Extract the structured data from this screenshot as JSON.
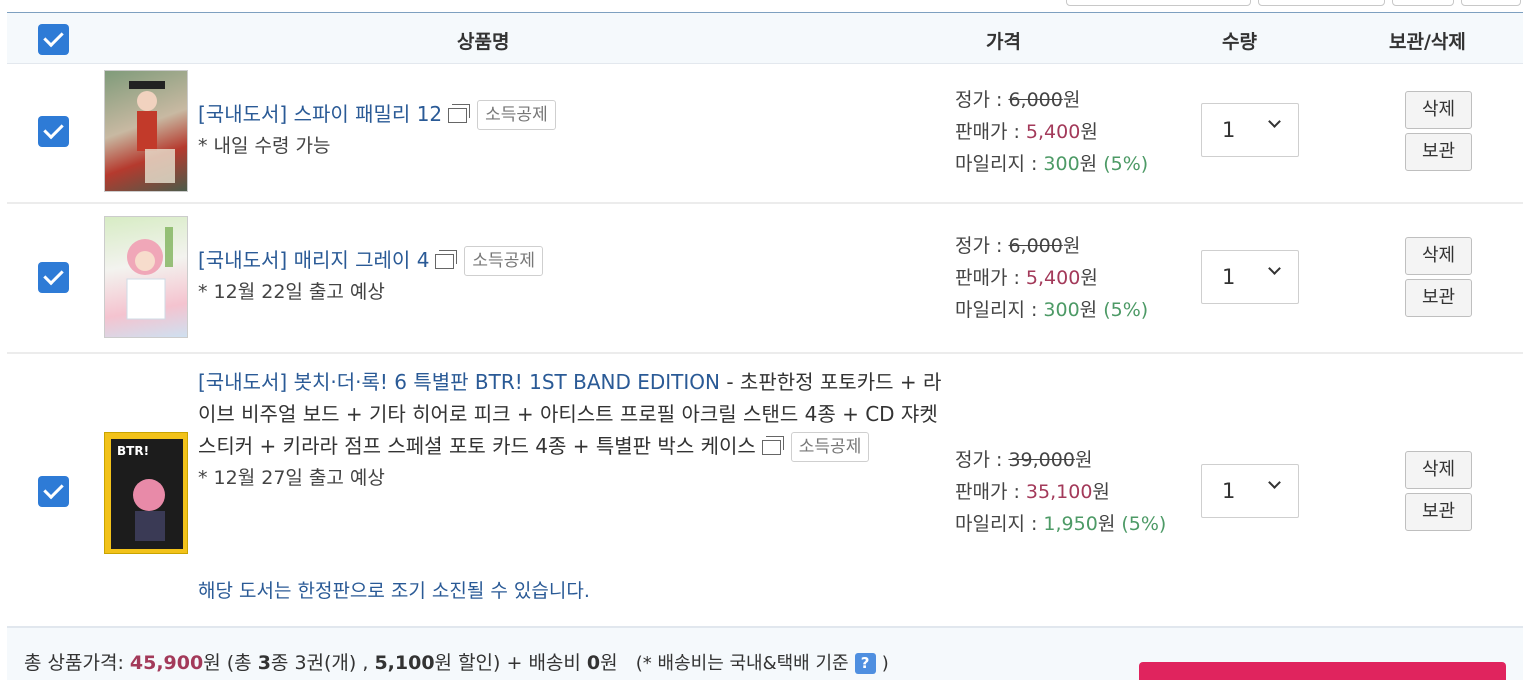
{
  "header": {
    "col_name": "상품명",
    "col_price": "가격",
    "col_qty": "수량",
    "col_action": "보관/삭제"
  },
  "items": [
    {
      "category": "[국내도서]",
      "title": "스파이 패밀리 12",
      "title_rest": "",
      "badge": "소득공제",
      "shipping": "* 내일 수령 가능",
      "list_label": "정가 : ",
      "list_price": "6,000",
      "sale_label": "판매가 : ",
      "sale_price": "5,400",
      "mileage_label": "마일리지 : ",
      "mileage": "300",
      "mileage_rate": "(5%)",
      "currency": "원",
      "qty": "1",
      "delete_label": "삭제",
      "keep_label": "보관",
      "cover_colors": [
        "#6e8a6a",
        "#c23a2a"
      ]
    },
    {
      "category": "[국내도서]",
      "title": "매리지 그레이 4",
      "title_rest": "",
      "badge": "소득공제",
      "shipping": "* 12월 22일 출고 예상",
      "list_label": "정가 : ",
      "list_price": "6,000",
      "sale_label": "판매가 : ",
      "sale_price": "5,400",
      "mileage_label": "마일리지 : ",
      "mileage": "300",
      "mileage_rate": "(5%)",
      "currency": "원",
      "qty": "1",
      "delete_label": "삭제",
      "keep_label": "보관",
      "cover_colors": [
        "#d9ecc8",
        "#f0a7b8"
      ]
    },
    {
      "category": "[국내도서]",
      "title": "봇치·더·록! 6 특별판 BTR! 1ST BAND EDITION",
      "title_rest": " - 초판한정 포토카드 + 라이브 비주얼 보드 + 기타 히어로 피크 + 아티스트 프로필 아크릴 스탠드 4종 + CD 쟈켓 스티커 + 키라라 점프 스페셜 포토 카드 4종 + 특별판 박스 케이스",
      "badge": "소득공제",
      "shipping": "* 12월 27일 출고 예상",
      "list_label": "정가 : ",
      "list_price": "39,000",
      "sale_label": "판매가 : ",
      "sale_price": "35,100",
      "mileage_label": "마일리지 : ",
      "mileage": "1,950",
      "mileage_rate": "(5%)",
      "currency": "원",
      "qty": "1",
      "delete_label": "삭제",
      "keep_label": "보관",
      "cover_colors": [
        "#f2c21a",
        "#1a1a1a"
      ],
      "notice": "해당 도서는 한정판으로 조기 소진될 수 있습니다."
    }
  ],
  "footer": {
    "label_total": "총 상품가격: ",
    "total": "45,900",
    "won": "원",
    "paren_open": " (총 ",
    "kinds": "3",
    "kinds_unit": "종 3권(개) , ",
    "discount": "5,100",
    "discount_unit": "원 할인) + 배송비 ",
    "shipping_fee": "0",
    "shipping_unit": "원",
    "shipping_note": "(* 배송비는 국내&택배 기준",
    "help_glyph": "?",
    "close_paren": ")"
  }
}
